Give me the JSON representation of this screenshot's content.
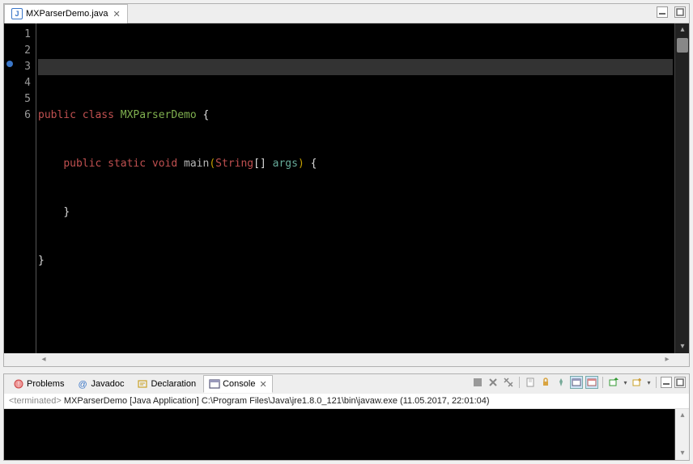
{
  "editor": {
    "tab": {
      "filename": "MXParserDemo.java",
      "icon_letter": "J"
    },
    "lines": [
      "1",
      "2",
      "3",
      "4",
      "5",
      "6"
    ],
    "code": {
      "l2": {
        "a": "public class ",
        "b": "MXParserDemo",
        "c": " {"
      },
      "l3": {
        "indent": "    ",
        "a": "public static void ",
        "b": "main",
        "po": "(",
        "c": "String",
        "d": "[] ",
        "e": "args",
        "pc": ")",
        "f": " {"
      },
      "l4": {
        "indent": "    ",
        "a": "}"
      },
      "l5": {
        "a": "}"
      }
    }
  },
  "views": {
    "problems": "Problems",
    "javadoc": "Javadoc",
    "declaration": "Declaration",
    "console": "Console"
  },
  "console": {
    "status_prefix": "<terminated>",
    "status_text": " MXParserDemo [Java Application] C:\\Program Files\\Java\\jre1.8.0_121\\bin\\javaw.exe (11.05.2017, 22:01:04)"
  }
}
